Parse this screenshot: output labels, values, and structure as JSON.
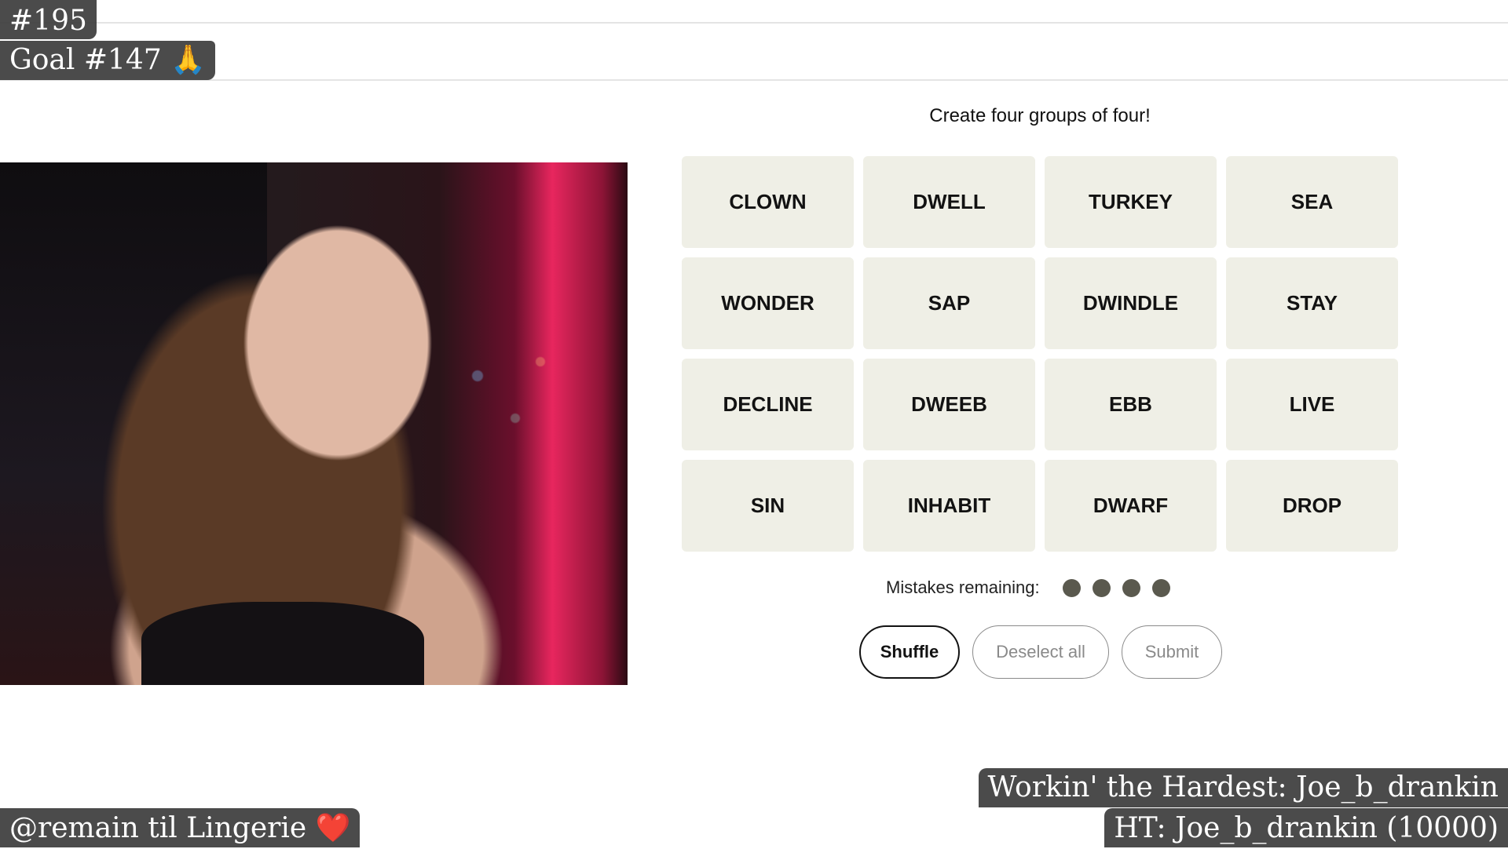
{
  "overlays": {
    "day_counter": "#195",
    "goal": "Goal #147 🙏",
    "remain": "@remain til Lingerie ❤️",
    "hardest": "Workin' the Hardest: Joe_b_drankin",
    "ht": "HT: Joe_b_drankin (10000)"
  },
  "game": {
    "instruction": "Create four groups of four!",
    "tiles": [
      "CLOWN",
      "DWELL",
      "TURKEY",
      "SEA",
      "WONDER",
      "SAP",
      "DWINDLE",
      "STAY",
      "DECLINE",
      "DWEEB",
      "EBB",
      "LIVE",
      "SIN",
      "INHABIT",
      "DWARF",
      "DROP"
    ],
    "mistakes_label": "Mistakes remaining:",
    "mistakes_remaining": 4,
    "buttons": {
      "shuffle": "Shuffle",
      "deselect": "Deselect all",
      "submit": "Submit"
    }
  },
  "colors": {
    "tile_bg": "#efefe6",
    "dot": "#5a594e",
    "overlay_bg": "#3c3c3c"
  }
}
